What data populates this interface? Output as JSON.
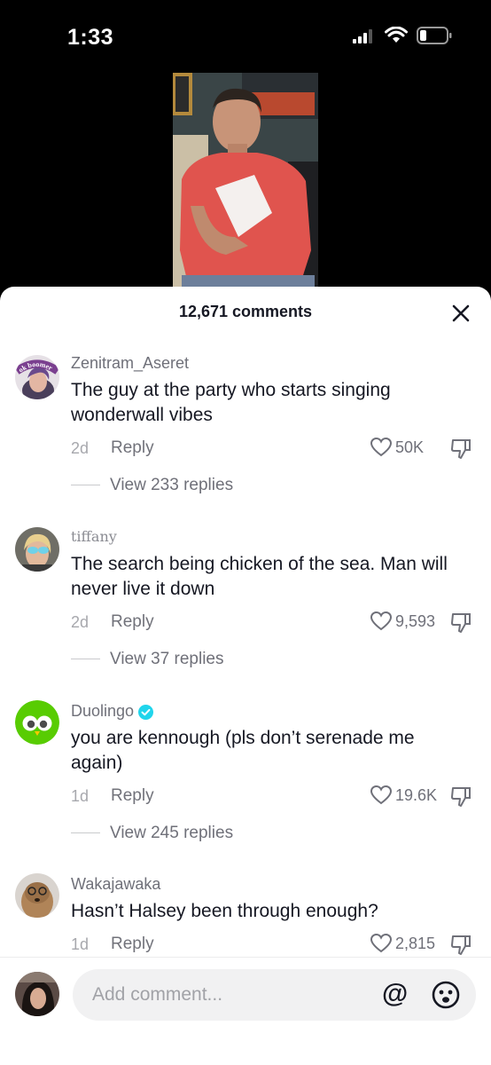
{
  "status_bar": {
    "time": "1:33"
  },
  "sheet": {
    "title": "12,671 comments"
  },
  "comments": [
    {
      "username": "Zenitram_Aseret",
      "text_lines": [
        "The guy at the party who starts singing",
        "wonderwall vibes"
      ],
      "age": "2d",
      "reply_label": "Reply",
      "likes": "50K",
      "view_replies": "View 233 replies",
      "avatar_text": "ok boomer"
    },
    {
      "username": "tiffany",
      "text_lines": [
        "The search being chicken of the sea. Man will",
        "never live it down"
      ],
      "age": "2d",
      "reply_label": "Reply",
      "likes": "9,593",
      "view_replies": "View 37 replies"
    },
    {
      "username": "Duolingo",
      "verified": true,
      "text_lines": [
        "you are kennough (pls don’t serenade me",
        "again)"
      ],
      "age": "1d",
      "reply_label": "Reply",
      "likes": "19.6K",
      "view_replies": "View 245 replies"
    },
    {
      "username": "Wakajawaka",
      "text_lines": [
        "Hasn’t Halsey been through enough?"
      ],
      "age": "1d",
      "reply_label": "Reply",
      "likes": "2,815"
    }
  ],
  "composer": {
    "placeholder": "Add comment...",
    "mention_symbol": "@"
  },
  "colors": {
    "verified": "#20d5ec",
    "duolingo_green": "#58cc02",
    "shirt": "#e8504b"
  }
}
